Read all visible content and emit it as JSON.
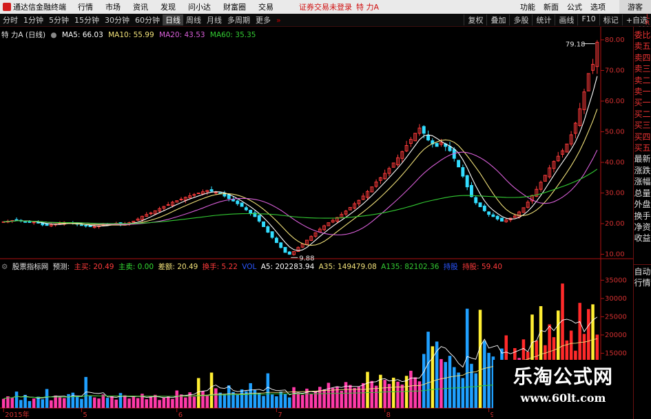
{
  "menubar": {
    "app_name": "通达信金融终端",
    "items": [
      "行情",
      "市场",
      "资讯",
      "发现",
      "问小达",
      "财富圈",
      "交易"
    ],
    "alert": "证券交易未登录",
    "stock": "特 力A",
    "right_items": [
      "功能",
      "新面",
      "公式",
      "选项"
    ],
    "guest": "游客"
  },
  "periodbar": {
    "periods": [
      "分时",
      "1分钟",
      "5分钟",
      "15分钟",
      "30分钟",
      "60分钟",
      "日线",
      "周线",
      "月线",
      "多周期",
      "更多"
    ],
    "active": "日线",
    "buttons": [
      "复权",
      "叠加",
      "多股",
      "统计",
      "画线",
      "F10",
      "标记",
      "+自选"
    ]
  },
  "corner": {
    "top": "L",
    "mid": "R",
    "bot": "000"
  },
  "price_info": {
    "title": "特 力A (日线)",
    "ma5": "MA5: 66.03",
    "ma10": "MA10: 55.99",
    "ma20": "MA20: 43.53",
    "ma60": "MA60: 35.35"
  },
  "volume_info": {
    "title": "股票指标网",
    "forecast": "预测:",
    "main_buy": "主买: 20.49",
    "main_sell": "主卖: 0.00",
    "diff": "差额: 20.49",
    "turnover": "换手: 5.22",
    "vol": "VOL",
    "a5": "A5: 202283.94",
    "a35": "A35: 149479.08",
    "a135": "A135: 82102.36",
    "hold": "持股",
    "hold_pct": "持股: 59.40"
  },
  "right_tabs": [
    "委比",
    "卖五",
    "卖四",
    "卖三",
    "卖二",
    "卖一",
    "买一",
    "买二",
    "买三",
    "买四",
    "买五",
    "最新",
    "涨跌",
    "涨幅",
    "总量",
    "外盘",
    "换手",
    "净资",
    "收益"
  ],
  "right_tabs2": [
    "自动",
    "行情"
  ],
  "watermark": {
    "line1": "乐淘公式网",
    "line2": "www.60lt.com"
  },
  "colors": {
    "up": "#ff3b3b",
    "down": "#33ddff",
    "ma5": "#ffffff",
    "ma10": "#f2e27a",
    "ma20": "#d95fd9",
    "ma60": "#33cc33",
    "axis": "#b31212",
    "vol_yellow": "#ffee33",
    "vol_red": "#ff2a2a",
    "vol_magenta": "#ff3aa8",
    "vol_cyan": "#1fa0ff"
  },
  "chart_data": [
    {
      "type": "candlestick",
      "title": "特 力A (日线)",
      "ylim": [
        9,
        82
      ],
      "y_ticks": [
        10.0,
        20.0,
        30.0,
        40.0,
        50.0,
        60.0,
        70.0,
        80.0
      ],
      "x_labels": [
        "2015年",
        "5",
        "6",
        "7",
        "8",
        "9"
      ],
      "annotations": [
        {
          "label": "79.18"
        },
        {
          "label": "9.88"
        }
      ],
      "series": [
        {
          "name": "K",
          "values": [
            20.6,
            20.8,
            21.0,
            21.3,
            20.9,
            20.4,
            20.6,
            20.5,
            20.2,
            19.6,
            19.4,
            19.7,
            19.8,
            20.1,
            20.4,
            20.2,
            20.0,
            19.8,
            19.5,
            19.2,
            19.0,
            19.1,
            19.3,
            19.6,
            19.8,
            20.0,
            20.1,
            19.8,
            19.9,
            20.3,
            20.8,
            21.5,
            22.4,
            23.0,
            23.5,
            24.2,
            24.9,
            25.6,
            26.2,
            27.0,
            27.5,
            28.0,
            28.6,
            29.1,
            29.5,
            30.0,
            30.4,
            30.8,
            30.6,
            30.2,
            29.8,
            29.0,
            28.2,
            27.4,
            26.5,
            25.6,
            24.5,
            23.4,
            22.3,
            20.8,
            19.0,
            17.2,
            15.5,
            13.8,
            12.2,
            10.6,
            10.0,
            10.9,
            12.2,
            13.4,
            14.6,
            15.8,
            17.0,
            18.2,
            19.3,
            20.3,
            21.1,
            22.0,
            23.0,
            24.1,
            25.3,
            26.5,
            27.6,
            29.0,
            30.5,
            32.0,
            33.6,
            35.0,
            36.4,
            38.0,
            39.8,
            41.5,
            43.5,
            45.5,
            47.5,
            49.5,
            51.2,
            49.5,
            47.3,
            46.0,
            45.2,
            46.5,
            45.2,
            43.8,
            41.3,
            38.5,
            35.5,
            32.0,
            28.8,
            26.8,
            25.5,
            24.2,
            23.0,
            22.3,
            21.5,
            20.8,
            21.2,
            21.8,
            22.5,
            23.8,
            25.2,
            27.0,
            29.2,
            31.2,
            33.5,
            35.8,
            38.2,
            40.3,
            42.0,
            43.8,
            46.0,
            49.0,
            52.8,
            57.5,
            63.0,
            69.0,
            72.0,
            79.2
          ]
        },
        {
          "name": "MA5",
          "values": [
            66.03
          ]
        },
        {
          "name": "MA10",
          "values": [
            55.99
          ]
        },
        {
          "name": "MA20",
          "values": [
            43.53
          ]
        },
        {
          "name": "MA60",
          "values": [
            35.35
          ]
        }
      ]
    },
    {
      "type": "bar",
      "title": "VOL",
      "ylim": [
        0,
        36000
      ],
      "y_ticks": [
        15000,
        20000,
        25000,
        30000,
        35000
      ],
      "series": [
        {
          "name": "VOL",
          "values": [
            2500,
            3200,
            2800,
            4500,
            2200,
            3600,
            1900,
            2600,
            3100,
            2400,
            5200,
            2100,
            3400,
            2900,
            2700,
            3800,
            4200,
            3000,
            2500,
            8500,
            3300,
            2900,
            2600,
            3700,
            2800,
            3200,
            2300,
            4100,
            3500,
            2600,
            3000,
            2700,
            3900,
            2400,
            3100,
            3600,
            2200,
            2800,
            3300,
            2500,
            4800,
            3700,
            2900,
            4300,
            3100,
            8200,
            4600,
            3600,
            9700,
            5400,
            4200,
            3900,
            6200,
            4400,
            3700,
            5100,
            4600,
            6800,
            4900,
            4100,
            3300,
            9500,
            3700,
            3200,
            4500,
            3800,
            2900,
            5700,
            4100,
            3600,
            5300,
            3900,
            4700,
            5800,
            5100,
            6900,
            5500,
            5900,
            4700,
            7100,
            6300,
            5500,
            5800,
            6800,
            9900,
            7400,
            6100,
            9100,
            7700,
            6600,
            8300,
            7200,
            6400,
            8800,
            10200,
            8400,
            7300,
            14800,
            20900,
            16900,
            18200,
            13400,
            12600,
            14300,
            11200,
            9700,
            8200,
            27200,
            12100,
            9500,
            26900,
            18400,
            15100,
            14100,
            11200,
            16300,
            19900,
            12800,
            16400,
            13700,
            18800,
            15400,
            25600,
            18500,
            27900,
            17200,
            22900,
            19400,
            26700,
            34100,
            18500,
            21200,
            15700,
            28800,
            20300,
            27100,
            28400,
            20100
          ]
        }
      ]
    }
  ]
}
